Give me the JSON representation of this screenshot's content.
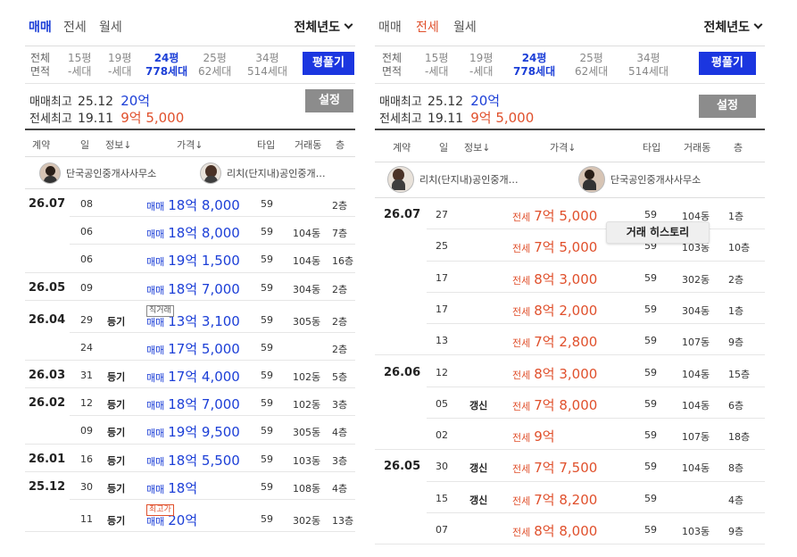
{
  "left": {
    "tabs": [
      "매매",
      "전세",
      "월세"
    ],
    "year_select": "전체년도",
    "sizes": [
      {
        "l1": "전체",
        "l2": "면적"
      },
      {
        "l1": "15평",
        "l2": "-세대"
      },
      {
        "l1": "19평",
        "l2": "-세대"
      },
      {
        "l1": "24평",
        "l2": "778세대"
      },
      {
        "l1": "25평",
        "l2": "62세대"
      },
      {
        "l1": "34평",
        "l2": "514세대"
      }
    ],
    "pyeong_button": "평풀기",
    "max_sale": {
      "label": "매매최고",
      "date": "25.12",
      "price": "20억"
    },
    "max_jeonse": {
      "label": "전세최고",
      "date": "19.11",
      "price": "9억 5,000"
    },
    "settings_button": "설정",
    "headers": [
      "계약",
      "일",
      "정보↓",
      "가격↓",
      "타입",
      "거래동",
      "층"
    ],
    "agents": [
      "단국공인중개사사무소",
      "리치(단지내)공인중개…"
    ],
    "rows": [
      {
        "contract": "26.07",
        "day": "08",
        "info": "",
        "ptype": "매매",
        "amount": "18억 8,000",
        "type": "59",
        "dong": "",
        "floor": "2층",
        "badge": ""
      },
      {
        "contract": "",
        "day": "06",
        "info": "",
        "ptype": "매매",
        "amount": "18억 8,000",
        "type": "59",
        "dong": "104동",
        "floor": "7층",
        "badge": ""
      },
      {
        "contract": "",
        "day": "06",
        "info": "",
        "ptype": "매매",
        "amount": "19억 1,500",
        "type": "59",
        "dong": "104동",
        "floor": "16층",
        "badge": ""
      },
      {
        "contract": "26.05",
        "day": "09",
        "info": "",
        "ptype": "매매",
        "amount": "18억 7,000",
        "type": "59",
        "dong": "304동",
        "floor": "2층",
        "badge": ""
      },
      {
        "contract": "26.04",
        "day": "29",
        "info": "등기",
        "ptype": "매매",
        "amount": "13억 3,100",
        "type": "59",
        "dong": "305동",
        "floor": "2층",
        "badge": "직거래"
      },
      {
        "contract": "",
        "day": "24",
        "info": "",
        "ptype": "매매",
        "amount": "17억 5,000",
        "type": "59",
        "dong": "",
        "floor": "2층",
        "badge": ""
      },
      {
        "contract": "26.03",
        "day": "31",
        "info": "등기",
        "ptype": "매매",
        "amount": "17억 4,000",
        "type": "59",
        "dong": "102동",
        "floor": "5층",
        "badge": ""
      },
      {
        "contract": "26.02",
        "day": "12",
        "info": "등기",
        "ptype": "매매",
        "amount": "18억 7,000",
        "type": "59",
        "dong": "102동",
        "floor": "3층",
        "badge": ""
      },
      {
        "contract": "",
        "day": "09",
        "info": "등기",
        "ptype": "매매",
        "amount": "19억 9,500",
        "type": "59",
        "dong": "305동",
        "floor": "4층",
        "badge": ""
      },
      {
        "contract": "26.01",
        "day": "16",
        "info": "등기",
        "ptype": "매매",
        "amount": "18억 5,500",
        "type": "59",
        "dong": "103동",
        "floor": "3층",
        "badge": ""
      },
      {
        "contract": "25.12",
        "day": "30",
        "info": "등기",
        "ptype": "매매",
        "amount": "18억",
        "type": "59",
        "dong": "108동",
        "floor": "4층",
        "badge": ""
      },
      {
        "contract": "",
        "day": "11",
        "info": "등기",
        "ptype": "매매",
        "amount": "20억",
        "type": "59",
        "dong": "302동",
        "floor": "13층",
        "badge": "최고가"
      }
    ]
  },
  "right": {
    "tabs": [
      "매매",
      "전세",
      "월세"
    ],
    "year_select": "전체년도",
    "sizes": [
      {
        "l1": "전체",
        "l2": "면적"
      },
      {
        "l1": "15평",
        "l2": "-세대"
      },
      {
        "l1": "19평",
        "l2": "-세대"
      },
      {
        "l1": "24평",
        "l2": "778세대"
      },
      {
        "l1": "25평",
        "l2": "62세대"
      },
      {
        "l1": "34평",
        "l2": "514세대"
      }
    ],
    "pyeong_button": "평풀기",
    "max_sale": {
      "label": "매매최고",
      "date": "25.12",
      "price": "20억"
    },
    "max_jeonse": {
      "label": "전세최고",
      "date": "19.11",
      "price": "9억 5,000"
    },
    "settings_button": "설정",
    "headers": [
      "계약",
      "일",
      "정보↓",
      "가격↓",
      "타입",
      "거래동",
      "층"
    ],
    "agents": [
      "리치(단지내)공인중개…",
      "단국공인중개사사무소"
    ],
    "tooltip": "거래 히스토리",
    "rows": [
      {
        "contract": "26.07",
        "day": "27",
        "info": "",
        "ptype": "전세",
        "amount": "7억 5,000",
        "type": "59",
        "dong": "104동",
        "floor": "1층"
      },
      {
        "contract": "",
        "day": "25",
        "info": "",
        "ptype": "전세",
        "amount": "7억 5,000",
        "type": "59",
        "dong": "103동",
        "floor": "10층"
      },
      {
        "contract": "",
        "day": "17",
        "info": "",
        "ptype": "전세",
        "amount": "8억 3,000",
        "type": "59",
        "dong": "302동",
        "floor": "2층"
      },
      {
        "contract": "",
        "day": "17",
        "info": "",
        "ptype": "전세",
        "amount": "8억 2,000",
        "type": "59",
        "dong": "304동",
        "floor": "1층"
      },
      {
        "contract": "",
        "day": "13",
        "info": "",
        "ptype": "전세",
        "amount": "7억 2,800",
        "type": "59",
        "dong": "107동",
        "floor": "9층"
      },
      {
        "contract": "26.06",
        "day": "12",
        "info": "",
        "ptype": "전세",
        "amount": "8억 3,000",
        "type": "59",
        "dong": "104동",
        "floor": "15층"
      },
      {
        "contract": "",
        "day": "05",
        "info": "갱신",
        "ptype": "전세",
        "amount": "7억 8,000",
        "type": "59",
        "dong": "104동",
        "floor": "6층"
      },
      {
        "contract": "",
        "day": "02",
        "info": "",
        "ptype": "전세",
        "amount": "9억",
        "type": "59",
        "dong": "107동",
        "floor": "18층"
      },
      {
        "contract": "26.05",
        "day": "30",
        "info": "갱신",
        "ptype": "전세",
        "amount": "7억 7,500",
        "type": "59",
        "dong": "104동",
        "floor": "8층"
      },
      {
        "contract": "",
        "day": "15",
        "info": "갱신",
        "ptype": "전세",
        "amount": "7억 8,200",
        "type": "59",
        "dong": "",
        "floor": "4층"
      },
      {
        "contract": "",
        "day": "07",
        "info": "",
        "ptype": "전세",
        "amount": "8억 8,000",
        "type": "59",
        "dong": "103동",
        "floor": "9층"
      }
    ]
  }
}
